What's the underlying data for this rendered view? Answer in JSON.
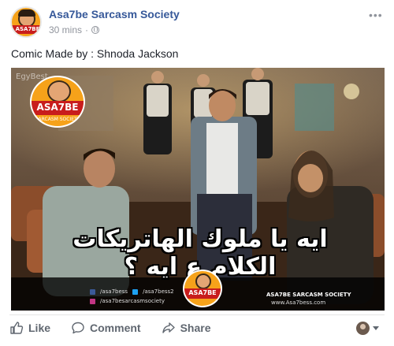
{
  "post": {
    "page_name": "Asa7be Sarcasm Society",
    "timestamp": "30 mins",
    "separator": "·",
    "caption": "Comic Made by : Shnoda Jackson",
    "more_icon": "more-horizontal-icon",
    "privacy_icon": "globe-icon"
  },
  "avatar": {
    "text": "ASA7BE"
  },
  "image": {
    "watermark": "EgyBest",
    "meme_text": "ايه يا ملوك الهاتريكات الكلام ع ايه ؟",
    "logo_main": "ASA7BE",
    "logo_sub": "SARCASM SOCIETY",
    "social": {
      "facebook": "/asa7bess",
      "twitter": "/asa7bess2",
      "instagram": "/asa7besarcasmsociety"
    },
    "brand_line": "ASA7BE SARCASM SOCIETY",
    "site_line": "www.Asa7bess.com",
    "colors": {
      "brand_orange": "#f6a21a",
      "brand_red": "#c81d1d",
      "link_blue": "#365899"
    }
  },
  "actions": {
    "like_label": "Like",
    "comment_label": "Comment",
    "share_label": "Share"
  }
}
